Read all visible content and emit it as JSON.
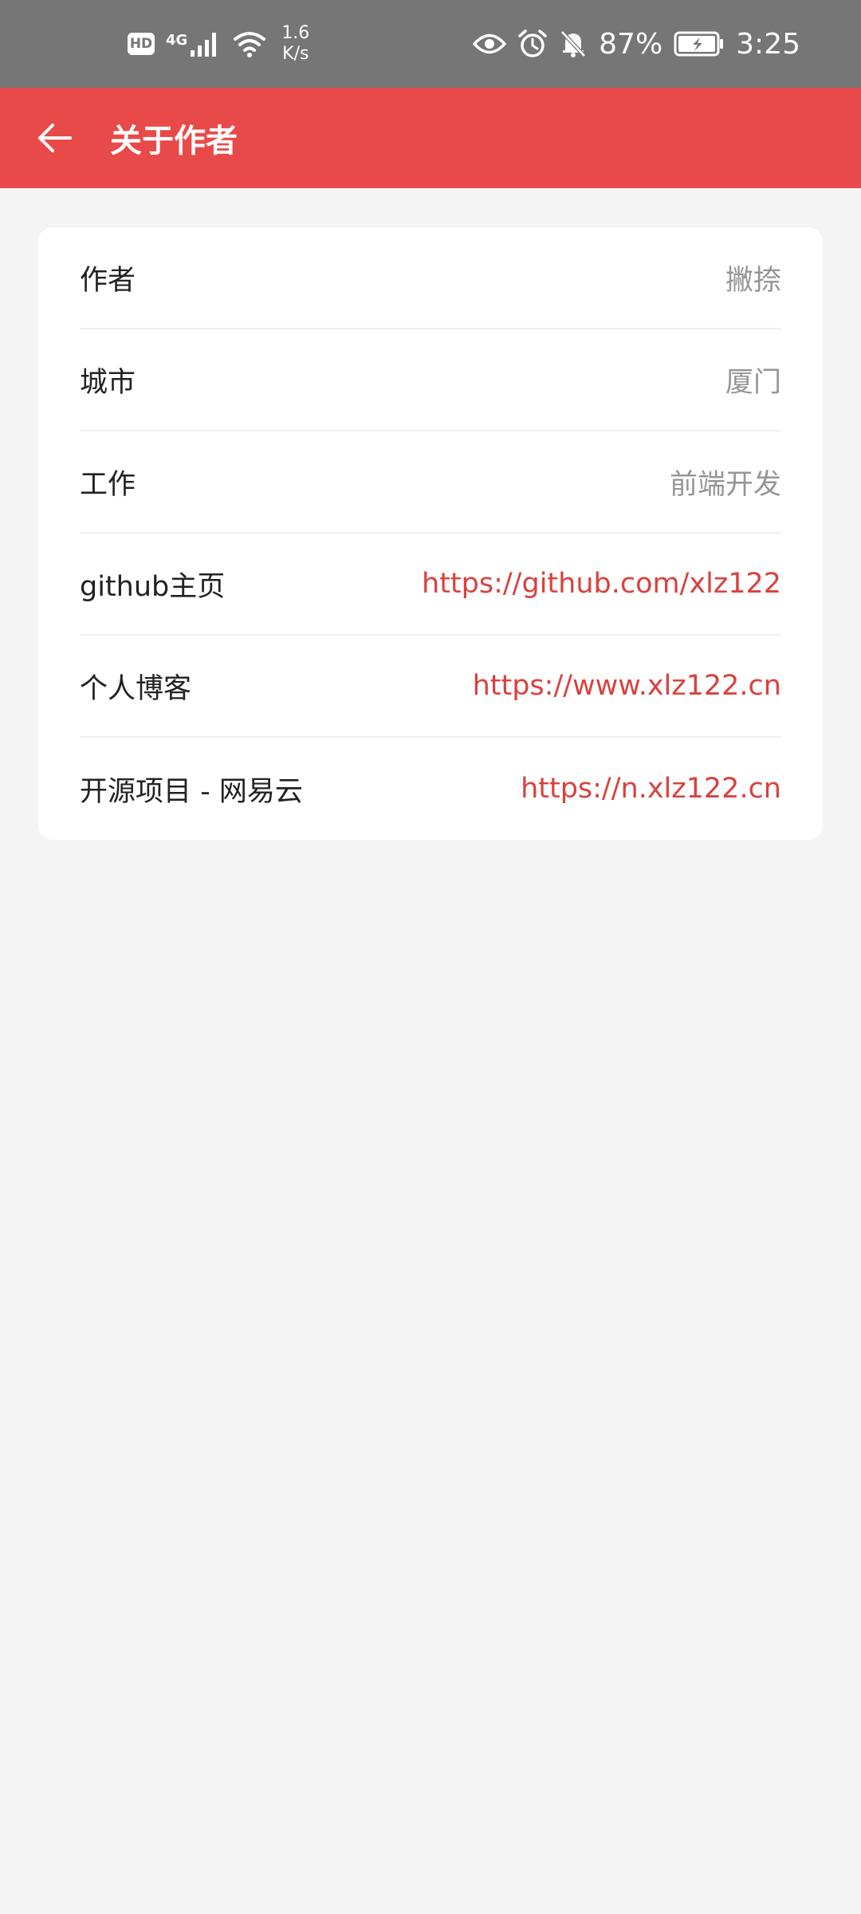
{
  "status_bar": {
    "hd": "HD",
    "network": "4G",
    "speed_value": "1.6",
    "speed_unit": "K/s",
    "battery": "87%",
    "time": "3:25"
  },
  "app_bar": {
    "title": "关于作者",
    "color": "#e84a49"
  },
  "info": {
    "rows": [
      {
        "label": "作者",
        "value": "撇捺"
      },
      {
        "label": "城市",
        "value": "厦门"
      },
      {
        "label": "工作",
        "value": "前端开发"
      },
      {
        "label": "github主页",
        "value": "https://github.com/xlz122"
      },
      {
        "label": "个人博客",
        "value": "https://www.xlz122.cn"
      },
      {
        "label": "开源项目 - 网易云",
        "value": "https://n.xlz122.cn"
      }
    ]
  }
}
